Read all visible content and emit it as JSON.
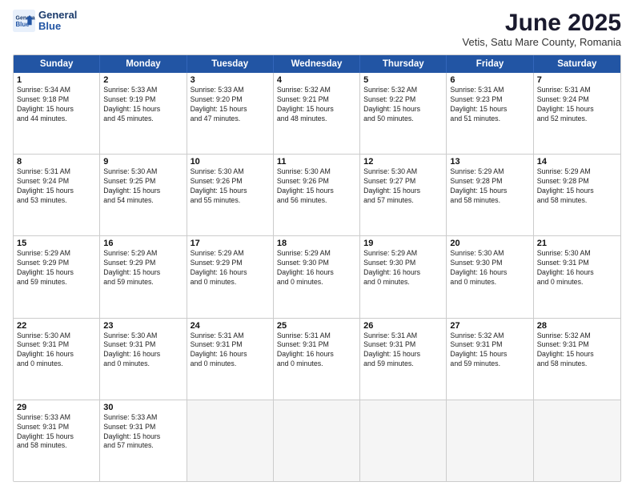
{
  "header": {
    "logo_line1": "General",
    "logo_line2": "Blue",
    "month": "June 2025",
    "location": "Vetis, Satu Mare County, Romania"
  },
  "weekdays": [
    "Sunday",
    "Monday",
    "Tuesday",
    "Wednesday",
    "Thursday",
    "Friday",
    "Saturday"
  ],
  "rows": [
    [
      {
        "day": "1",
        "info": "Sunrise: 5:34 AM\nSunset: 9:18 PM\nDaylight: 15 hours\nand 44 minutes."
      },
      {
        "day": "2",
        "info": "Sunrise: 5:33 AM\nSunset: 9:19 PM\nDaylight: 15 hours\nand 45 minutes."
      },
      {
        "day": "3",
        "info": "Sunrise: 5:33 AM\nSunset: 9:20 PM\nDaylight: 15 hours\nand 47 minutes."
      },
      {
        "day": "4",
        "info": "Sunrise: 5:32 AM\nSunset: 9:21 PM\nDaylight: 15 hours\nand 48 minutes."
      },
      {
        "day": "5",
        "info": "Sunrise: 5:32 AM\nSunset: 9:22 PM\nDaylight: 15 hours\nand 50 minutes."
      },
      {
        "day": "6",
        "info": "Sunrise: 5:31 AM\nSunset: 9:23 PM\nDaylight: 15 hours\nand 51 minutes."
      },
      {
        "day": "7",
        "info": "Sunrise: 5:31 AM\nSunset: 9:24 PM\nDaylight: 15 hours\nand 52 minutes."
      }
    ],
    [
      {
        "day": "8",
        "info": "Sunrise: 5:31 AM\nSunset: 9:24 PM\nDaylight: 15 hours\nand 53 minutes."
      },
      {
        "day": "9",
        "info": "Sunrise: 5:30 AM\nSunset: 9:25 PM\nDaylight: 15 hours\nand 54 minutes."
      },
      {
        "day": "10",
        "info": "Sunrise: 5:30 AM\nSunset: 9:26 PM\nDaylight: 15 hours\nand 55 minutes."
      },
      {
        "day": "11",
        "info": "Sunrise: 5:30 AM\nSunset: 9:26 PM\nDaylight: 15 hours\nand 56 minutes."
      },
      {
        "day": "12",
        "info": "Sunrise: 5:30 AM\nSunset: 9:27 PM\nDaylight: 15 hours\nand 57 minutes."
      },
      {
        "day": "13",
        "info": "Sunrise: 5:29 AM\nSunset: 9:28 PM\nDaylight: 15 hours\nand 58 minutes."
      },
      {
        "day": "14",
        "info": "Sunrise: 5:29 AM\nSunset: 9:28 PM\nDaylight: 15 hours\nand 58 minutes."
      }
    ],
    [
      {
        "day": "15",
        "info": "Sunrise: 5:29 AM\nSunset: 9:29 PM\nDaylight: 15 hours\nand 59 minutes."
      },
      {
        "day": "16",
        "info": "Sunrise: 5:29 AM\nSunset: 9:29 PM\nDaylight: 15 hours\nand 59 minutes."
      },
      {
        "day": "17",
        "info": "Sunrise: 5:29 AM\nSunset: 9:29 PM\nDaylight: 16 hours\nand 0 minutes."
      },
      {
        "day": "18",
        "info": "Sunrise: 5:29 AM\nSunset: 9:30 PM\nDaylight: 16 hours\nand 0 minutes."
      },
      {
        "day": "19",
        "info": "Sunrise: 5:29 AM\nSunset: 9:30 PM\nDaylight: 16 hours\nand 0 minutes."
      },
      {
        "day": "20",
        "info": "Sunrise: 5:30 AM\nSunset: 9:30 PM\nDaylight: 16 hours\nand 0 minutes."
      },
      {
        "day": "21",
        "info": "Sunrise: 5:30 AM\nSunset: 9:31 PM\nDaylight: 16 hours\nand 0 minutes."
      }
    ],
    [
      {
        "day": "22",
        "info": "Sunrise: 5:30 AM\nSunset: 9:31 PM\nDaylight: 16 hours\nand 0 minutes."
      },
      {
        "day": "23",
        "info": "Sunrise: 5:30 AM\nSunset: 9:31 PM\nDaylight: 16 hours\nand 0 minutes."
      },
      {
        "day": "24",
        "info": "Sunrise: 5:31 AM\nSunset: 9:31 PM\nDaylight: 16 hours\nand 0 minutes."
      },
      {
        "day": "25",
        "info": "Sunrise: 5:31 AM\nSunset: 9:31 PM\nDaylight: 16 hours\nand 0 minutes."
      },
      {
        "day": "26",
        "info": "Sunrise: 5:31 AM\nSunset: 9:31 PM\nDaylight: 15 hours\nand 59 minutes."
      },
      {
        "day": "27",
        "info": "Sunrise: 5:32 AM\nSunset: 9:31 PM\nDaylight: 15 hours\nand 59 minutes."
      },
      {
        "day": "28",
        "info": "Sunrise: 5:32 AM\nSunset: 9:31 PM\nDaylight: 15 hours\nand 58 minutes."
      }
    ],
    [
      {
        "day": "29",
        "info": "Sunrise: 5:33 AM\nSunset: 9:31 PM\nDaylight: 15 hours\nand 58 minutes."
      },
      {
        "day": "30",
        "info": "Sunrise: 5:33 AM\nSunset: 9:31 PM\nDaylight: 15 hours\nand 57 minutes."
      },
      {
        "day": "",
        "info": ""
      },
      {
        "day": "",
        "info": ""
      },
      {
        "day": "",
        "info": ""
      },
      {
        "day": "",
        "info": ""
      },
      {
        "day": "",
        "info": ""
      }
    ]
  ]
}
